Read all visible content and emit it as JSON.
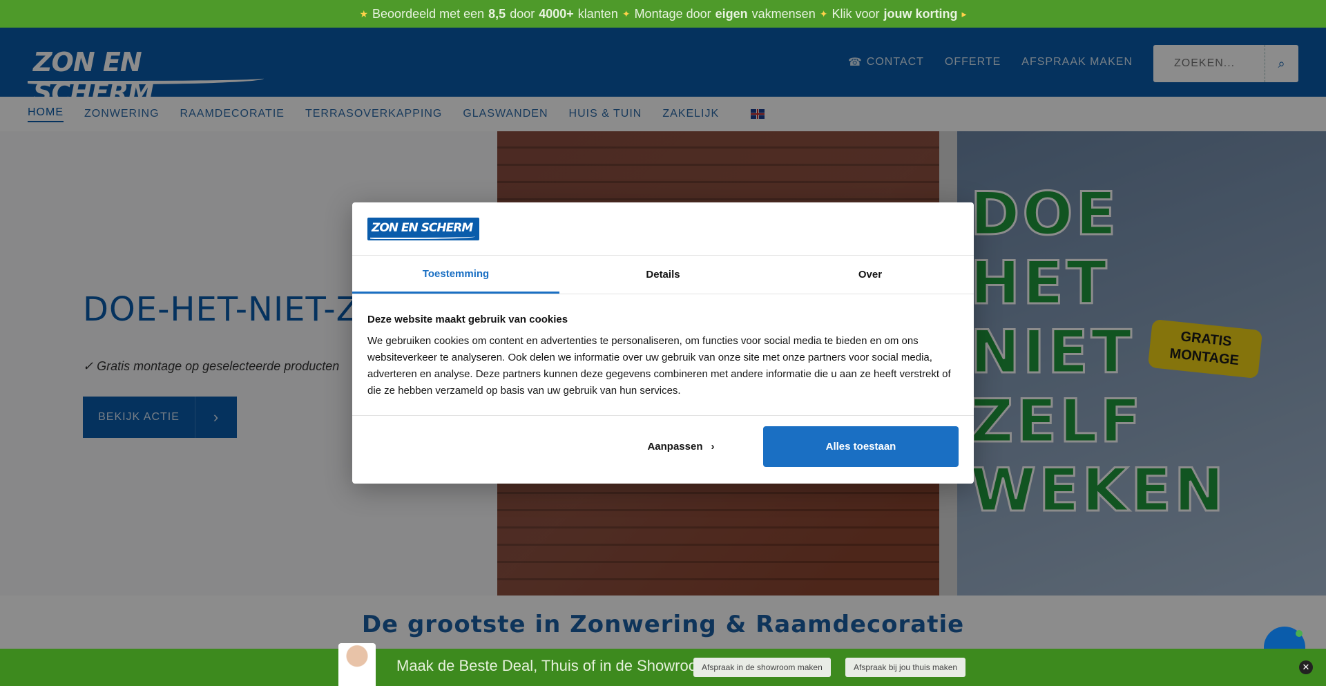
{
  "topbar": {
    "part1": "Beoordeeld met een",
    "rating": "8,5",
    "part2": "door",
    "customers": "4000+",
    "part3": "klanten",
    "part4": "Montage door",
    "own": "eigen",
    "part5": "vakmensen",
    "part6": "Klik voor",
    "discount": "jouw korting"
  },
  "header": {
    "logo_text": "ZON EN SCHERM",
    "links": {
      "contact": "CONTACT",
      "quote": "OFFERTE",
      "appointment": "AFSPRAAK MAKEN"
    },
    "search_placeholder": "ZOEKEN..."
  },
  "nav": {
    "items": [
      "HOME",
      "ZONWERING",
      "RAAMDECORATIE",
      "TERRASOVERKAPPING",
      "GLASWANDEN",
      "HUIS & TUIN",
      "ZAKELIJK"
    ]
  },
  "hero": {
    "title": "DOE-HET-NIET-ZELF W",
    "subtitle": "Gratis montage op geselecteerde producten",
    "button": "BEKIJK ACTIE",
    "promo_lines": [
      "DOE HET",
      "NIET ZELF",
      "WEKEN"
    ],
    "badge": [
      "GRATIS",
      "MONTAGE"
    ]
  },
  "section_title": "De grootste in Zonwering & Raamdecoratie",
  "bottombar": {
    "text": "Maak de Beste Deal, Thuis of in de Showroom!",
    "btn_showroom": "Afspraak in de showroom maken",
    "btn_home": "Afspraak bij jou thuis maken"
  },
  "dialog": {
    "logo_text": "ZON EN SCHERM",
    "tabs": [
      "Toestemming",
      "Details",
      "Over"
    ],
    "heading": "Deze website maakt gebruik van cookies",
    "body": "We gebruiken cookies om content en advertenties te personaliseren, om functies voor social media te bieden en om ons websiteverkeer te analyseren. Ook delen we informatie over uw gebruik van onze site met onze partners voor social media, adverteren en analyse. Deze partners kunnen deze gegevens combineren met andere informatie die u aan ze heeft verstrekt of die ze hebben verzameld op basis van uw gebruik van hun services.",
    "customize": "Aanpassen",
    "allow_all": "Alles toestaan"
  },
  "colors": {
    "brand_blue": "#0a5cab",
    "green": "#4e9a2a",
    "accept_blue": "#1a6fc3"
  }
}
